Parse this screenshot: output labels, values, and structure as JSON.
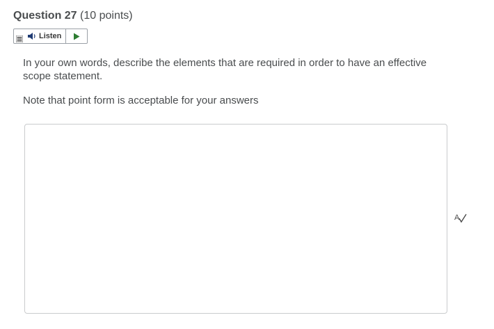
{
  "question": {
    "title": "Question 27",
    "points": "(10 points)",
    "prompt": "In your own words, describe the elements that are required in order to have an effective scope statement.",
    "note": "Note that point form is acceptable for your answers"
  },
  "listen": {
    "label": "Listen",
    "icons": {
      "menu": "menu-lines-icon",
      "speaker": "speaker-icon",
      "play": "play-icon"
    },
    "play_color": "#2e7d32"
  },
  "answer": {
    "value": "",
    "spellcheck_icon": "spellcheck-icon"
  }
}
